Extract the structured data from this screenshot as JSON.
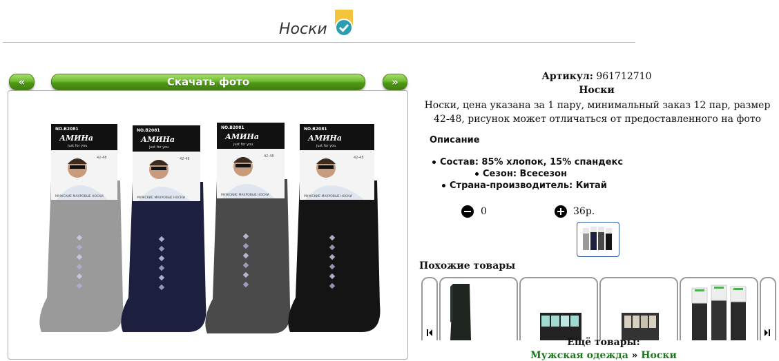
{
  "header": {
    "title": "Носки"
  },
  "photo_nav": {
    "prev_label": "«",
    "download_label": "Скачать фото",
    "next_label": "»"
  },
  "product": {
    "sku_label": "Артикул:",
    "sku_value": "961712710",
    "name": "Носки",
    "description": "Носки, цена указана за 1 пару, минимальный заказ 12 пар, размер 42-48, рисунок может отличаться от предоставленного на фото",
    "desc_heading": "Описание",
    "specs": [
      "Состав: 85% хлопок, 15% спандекс",
      "Сезон: Всесезон",
      "Страна-производитель: Китай"
    ],
    "quantity": "0",
    "price": "36р."
  },
  "package": {
    "number": "NO.B2081",
    "brand": "АМИНа",
    "tagline": "just for you",
    "subtitle": "МУЖСКИЕ МАХРОВЫЕ НОСКИ",
    "size": "42-48",
    "sock_colors": [
      "#9a9a9a",
      "#1c1f3d",
      "#4a4a4a",
      "#141414"
    ]
  },
  "similar": {
    "heading": "Похожие товары"
  },
  "footer": {
    "more_label": "Ещё товары:",
    "crumb_parent": "Мужская одежда",
    "crumb_sep": "»",
    "crumb_current": "Носки"
  },
  "colors": {
    "accent_green": "#5aa81e",
    "link_green": "#1a7a1a",
    "thumb_border": "#2d5a9e"
  },
  "icons": [
    "verified-badge-icon",
    "minus-circle-icon",
    "plus-circle-icon",
    "arrow-left-icon",
    "arrow-right-icon"
  ]
}
